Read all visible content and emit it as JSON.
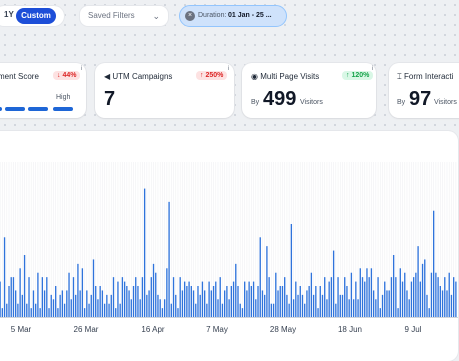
{
  "filters": {
    "period_1y": "1Y",
    "period_custom": "Custom",
    "saved_filters": "Saved Filters",
    "duration_label": "Duration:",
    "duration_value": "01 Jan - 25 ..."
  },
  "cards": {
    "engagement": {
      "title": "ment Score",
      "change": "44%",
      "level_label": "High"
    },
    "utm": {
      "title": "UTM Campaigns",
      "change": "250%",
      "value": "7"
    },
    "multipage": {
      "title": "Multi Page Visits",
      "change": "120%",
      "prefix": "By",
      "value": "499",
      "suffix": "Visitors"
    },
    "forms": {
      "title": "Form Interacti",
      "prefix": "By",
      "value": "97",
      "suffix": "Visitors"
    }
  },
  "colors": {
    "accent": "#1d4ed8",
    "bar": "#2f73db",
    "negative": "#dc2626",
    "positive": "#16a34a"
  },
  "icons": [
    "info-icon",
    "megaphone-icon",
    "eye-icon",
    "cursor-icon",
    "close-icon",
    "chevron-down-icon",
    "arrow-up-icon",
    "arrow-down-icon"
  ],
  "chart_data": {
    "type": "bar",
    "x_tick_labels": [
      "5 Mar",
      "26 Mar",
      "16 Apr",
      "7 May",
      "28 May",
      "18 Jun",
      "9 Jul"
    ],
    "values": [
      8,
      2,
      18,
      3,
      7,
      9,
      9,
      6,
      3,
      11,
      5,
      14,
      3,
      9,
      2,
      6,
      3,
      10,
      2,
      9,
      6,
      9,
      2,
      5,
      4,
      7,
      2,
      5,
      6,
      3,
      6,
      10,
      4,
      9,
      5,
      12,
      6,
      11,
      2,
      6,
      3,
      5,
      13,
      7,
      4,
      7,
      6,
      3,
      5,
      3,
      5,
      9,
      2,
      8,
      3,
      9,
      8,
      7,
      6,
      4,
      7,
      9,
      7,
      4,
      9,
      29,
      5,
      6,
      9,
      12,
      10,
      5,
      4,
      2,
      4,
      11,
      26,
      3,
      9,
      5,
      2,
      9,
      6,
      8,
      7,
      8,
      7,
      6,
      3,
      7,
      5,
      8,
      6,
      3,
      8,
      6,
      7,
      8,
      4,
      9,
      3,
      6,
      7,
      4,
      7,
      8,
      12,
      7,
      3,
      2,
      8,
      6,
      8,
      7,
      8,
      4,
      7,
      18,
      6,
      5,
      16,
      9,
      3,
      3,
      10,
      6,
      7,
      7,
      9,
      5,
      3,
      21,
      4,
      8,
      5,
      7,
      5,
      3,
      6,
      7,
      10,
      5,
      7,
      2,
      7,
      5,
      9,
      4,
      8,
      9,
      15,
      3,
      9,
      5,
      5,
      9,
      7,
      4,
      10,
      4,
      8,
      4,
      11,
      9,
      8,
      11,
      9,
      11,
      6,
      4,
      9,
      2,
      5,
      8,
      6,
      6,
      9,
      14,
      9,
      2,
      11,
      8,
      10,
      6,
      4,
      8,
      9,
      10,
      16,
      8,
      12,
      13,
      5,
      2,
      10,
      24,
      10,
      9,
      7,
      6,
      9,
      6,
      10,
      5,
      9,
      8
    ],
    "ylim": [
      0,
      35
    ]
  }
}
